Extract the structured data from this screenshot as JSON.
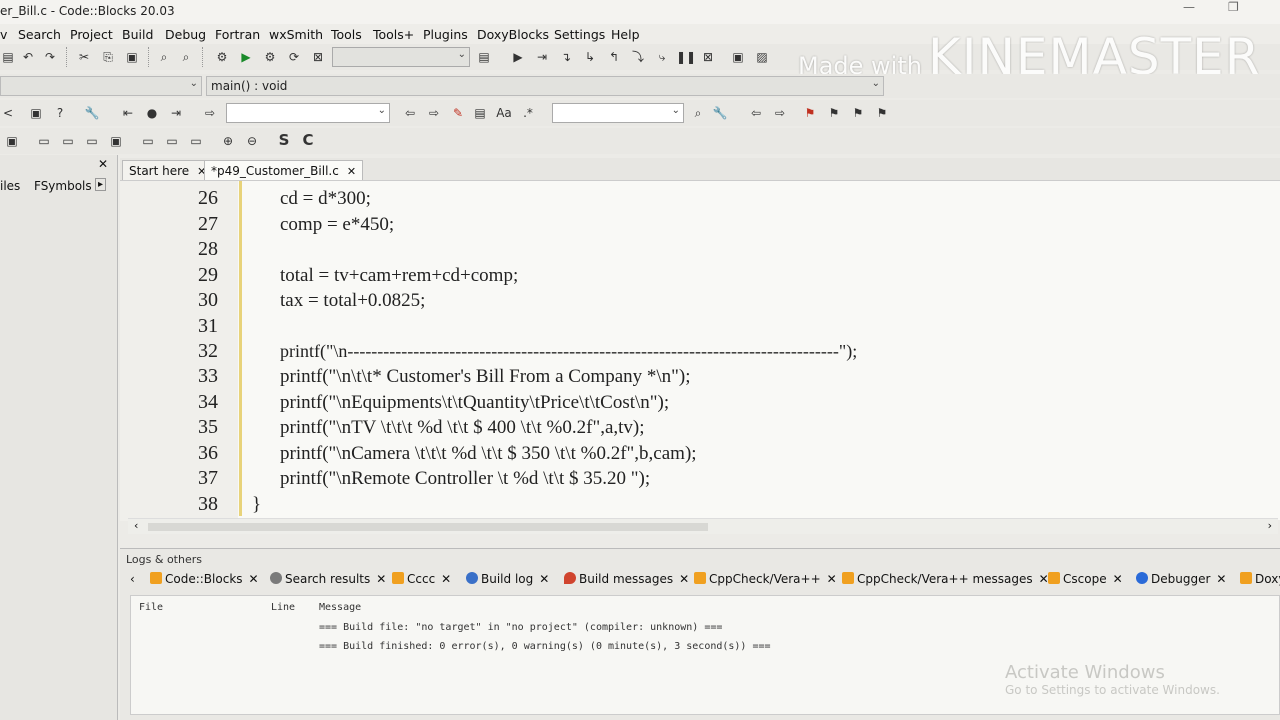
{
  "window": {
    "title": "er_Bill.c - Code::Blocks 20.03"
  },
  "menu": [
    "v",
    "Search",
    "Project",
    "Build",
    "Debug",
    "Fortran",
    "wxSmith",
    "Tools",
    "Tools+",
    "Plugins",
    "DoxyBlocks",
    "Settings",
    "Help"
  ],
  "toolbar": {
    "scope_combo": "",
    "function_combo": "main() : void",
    "search_combo_1": "",
    "search_combo_2": ""
  },
  "watermark": {
    "made_with": "Made with",
    "brand": "KINEMASTER"
  },
  "left_panel": {
    "tabs": [
      "iles",
      "FSymbols"
    ]
  },
  "editor_tabs": [
    {
      "label": "Start here"
    },
    {
      "label": "*p49_Customer_Bill.c"
    }
  ],
  "code": {
    "lines": [
      {
        "n": "26",
        "text": "cd = d*300;"
      },
      {
        "n": "27",
        "text": "comp = e*450;"
      },
      {
        "n": "28",
        "text": ""
      },
      {
        "n": "29",
        "text": "total = tv+cam+rem+cd+comp;"
      },
      {
        "n": "30",
        "text": "tax = total+0.0825;"
      },
      {
        "n": "31",
        "text": ""
      },
      {
        "n": "32",
        "text": "printf(\"\\n----------------------------------------------------------------------------------\");"
      },
      {
        "n": "33",
        "text": "printf(\"\\n\\t\\t* Customer's Bill From a Company *\\n\");"
      },
      {
        "n": "34",
        "text": "printf(\"\\nEquipments\\t\\tQuantity\\tPrice\\t\\tCost\\n\");"
      },
      {
        "n": "35",
        "text": "printf(\"\\nTV \\t\\t\\t %d \\t\\t $ 400 \\t\\t %0.2f\",a,tv);"
      },
      {
        "n": "36",
        "text": "printf(\"\\nCamera \\t\\t\\t %d \\t\\t $ 350 \\t\\t %0.2f\",b,cam);"
      },
      {
        "n": "37",
        "text": "printf(\"\\nRemote Controller \\t %d \\t\\t $ 35.20 \");"
      },
      {
        "n": "38",
        "text": "}"
      }
    ]
  },
  "logs": {
    "header": "Logs & others",
    "tabs": [
      {
        "label": "Code::Blocks",
        "color": "#f0a020"
      },
      {
        "label": "Search results",
        "color": "#7a7a7a"
      },
      {
        "label": "Cccc",
        "color": "#f0a020"
      },
      {
        "label": "Build log",
        "color": "#3a70c8"
      },
      {
        "label": "Build messages",
        "color": "#d0442e"
      },
      {
        "label": "CppCheck/Vera++",
        "color": "#f0a020"
      },
      {
        "label": "CppCheck/Vera++ messages",
        "color": "#f0a020"
      },
      {
        "label": "Cscope",
        "color": "#f0a020"
      },
      {
        "label": "Debugger",
        "color": "#2a6ad8"
      },
      {
        "label": "Doxy",
        "color": "#f0a020"
      }
    ],
    "columns": [
      "File",
      "Line",
      "Message"
    ],
    "messages": [
      "=== Build file: \"no target\" in \"no project\" (compiler: unknown) ===",
      "=== Build finished: 0 error(s), 0 warning(s) (0 minute(s), 3 second(s)) ==="
    ]
  },
  "activate": {
    "line1": "Activate Windows",
    "line2": "Go to Settings to activate Windows."
  }
}
